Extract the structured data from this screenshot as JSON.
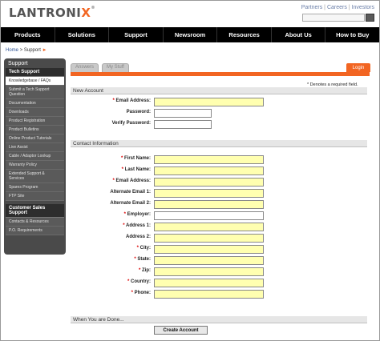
{
  "header": {
    "logo_main": "LANTRONI",
    "logo_x": "X",
    "logo_tm": "®",
    "toplinks": [
      "Partners",
      "Careers",
      "Investors"
    ],
    "separator": "|"
  },
  "nav": [
    "Products",
    "Solutions",
    "Support",
    "Newsroom",
    "Resources",
    "About Us",
    "How to Buy"
  ],
  "breadcrumb": {
    "home": "Home",
    "sep": ">",
    "current": "Support",
    "arrow": "►"
  },
  "sidebar": {
    "title": "Support",
    "group1_head": "Tech Support",
    "group1_items": [
      "Knowledgebase / FAQs",
      "Submit a Tech Support Question",
      "Documentation",
      "Downloads",
      "Product Registration",
      "Product Bulletins",
      "Online Product Tutorials",
      "Live Assist",
      "Cable / Adaptor Lookup",
      "Warranty Policy",
      "Extended Support & Services",
      "Spares Program",
      "FTP Site"
    ],
    "group2_head": "Customer Sales Support",
    "group2_items": [
      "Contacts & Resources",
      "P.O. Requirements"
    ]
  },
  "tabs": {
    "answers": "Answers",
    "my_stuff": "My Stuff",
    "login": "Login"
  },
  "required_note": "* Denotes a required field.",
  "sections": {
    "new_account": "New Account",
    "contact_info": "Contact Information",
    "done": "When You are Done..."
  },
  "fields": {
    "email": {
      "label": "Email Address:",
      "required": true
    },
    "password": {
      "label": "Password:",
      "required": false
    },
    "verify": {
      "label": "Verify Password:",
      "required": false
    },
    "first": {
      "label": "First Name:",
      "required": true
    },
    "last": {
      "label": "Last Name:",
      "required": true
    },
    "email2": {
      "label": "Email Address:",
      "required": true
    },
    "alt1": {
      "label": "Alternate Email 1:",
      "required": false
    },
    "alt2": {
      "label": "Alternate Email 2:",
      "required": false
    },
    "employer": {
      "label": "Employer:",
      "required": true
    },
    "addr1": {
      "label": "Address 1:",
      "required": true
    },
    "addr2": {
      "label": "Address 2:",
      "required": false
    },
    "city": {
      "label": "City:",
      "required": true
    },
    "state": {
      "label": "State:",
      "required": true
    },
    "zip": {
      "label": "Zip:",
      "required": true
    },
    "country": {
      "label": "Country:",
      "required": true
    },
    "phone": {
      "label": "Phone:",
      "required": true
    }
  },
  "star": "*",
  "submit_label": "Create Account"
}
